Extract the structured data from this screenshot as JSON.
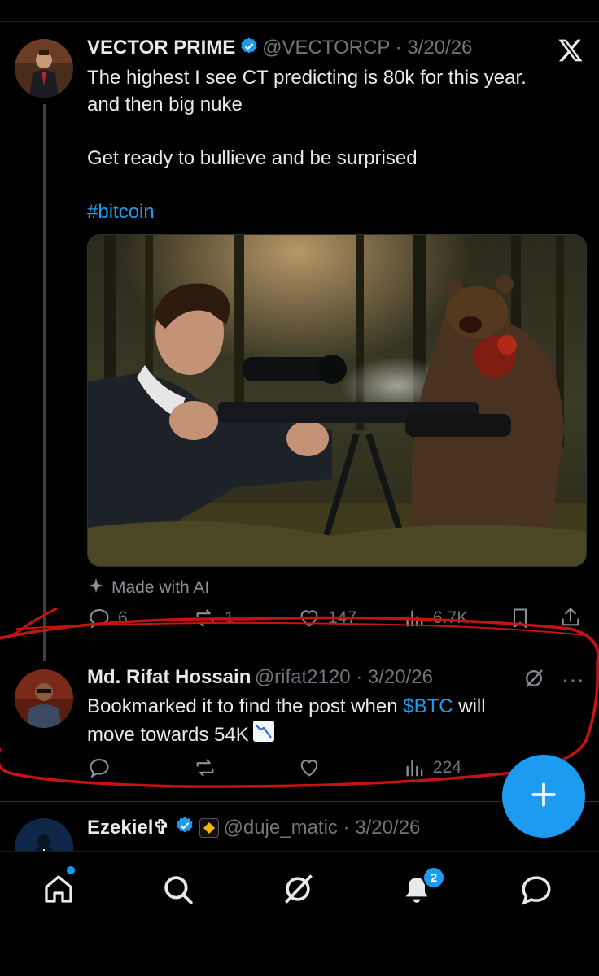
{
  "colors": {
    "accent": "#1d9bf0",
    "annotation": "#c51212",
    "background": "#000000"
  },
  "post": {
    "author_name": "VECTOR PRIME",
    "handle_date": "@VECTORCP · 3/20/26",
    "line1": "The highest I see CT predicting  is 80k for this year.",
    "line2": "and then big nuke",
    "line3": "Get ready to bullieve and be surprised",
    "hashtag": "#bitcoin",
    "media_label": "Made with AI",
    "replies": "6",
    "reposts": "1",
    "likes": "147",
    "views": "6.7K"
  },
  "reply": {
    "author_name": "Md. Rifat Hossain",
    "handle_date": "@rifat2120 · 3/20/26",
    "text_before": "Bookmarked it to find the post when ",
    "cashtag": "$BTC",
    "text_after": " will",
    "line2": "move towards 54K",
    "views": "224"
  },
  "next_post": {
    "author_name": "Ezekiel✞",
    "handle_date": "@duje_matic · 3/20/26"
  },
  "nav": {
    "notification_count": "2",
    "icons": [
      "home-icon",
      "search-icon",
      "grok-icon",
      "notifications-icon",
      "messages-icon"
    ]
  },
  "brand": "x-logo-icon"
}
